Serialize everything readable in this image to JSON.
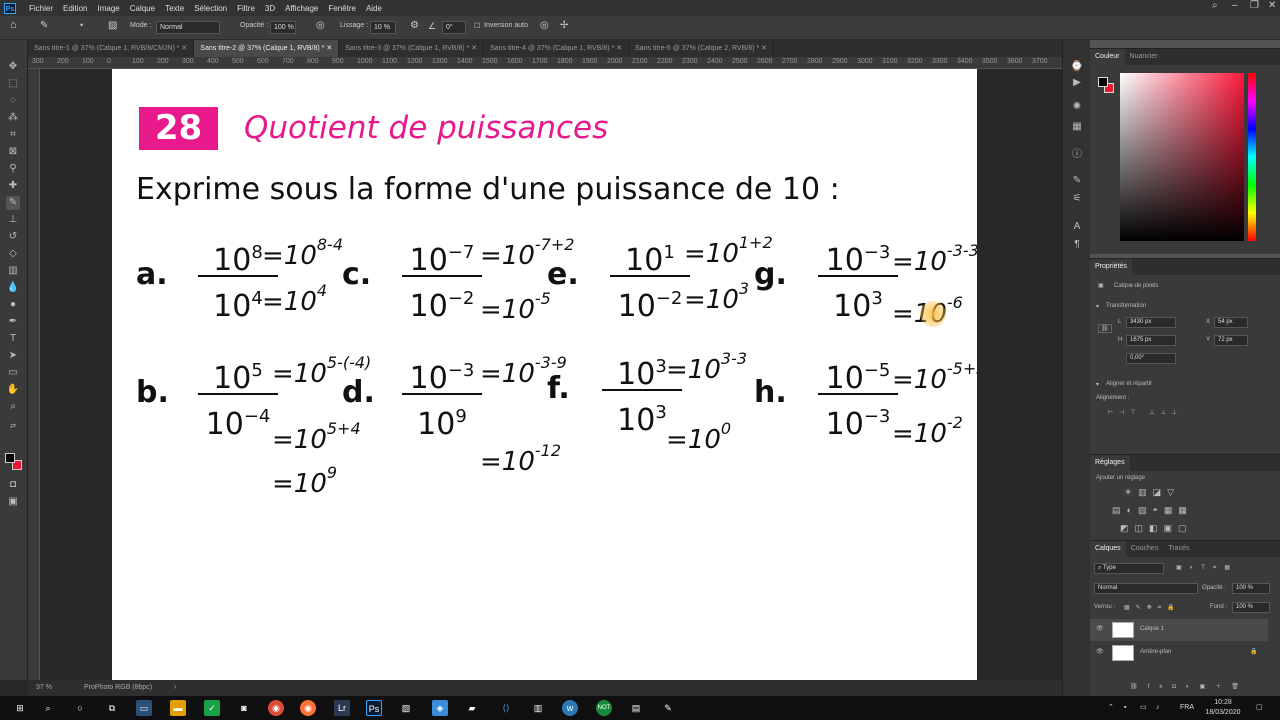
{
  "menubar": {
    "items": [
      "Fichier",
      "Edition",
      "Image",
      "Calque",
      "Texte",
      "Sélection",
      "Filtre",
      "3D",
      "Affichage",
      "Fenêtre",
      "Aide"
    ]
  },
  "options": {
    "mode_label": "Mode :",
    "mode_value": "Normal",
    "opacity_label": "Opacité :",
    "opacity_value": "100 %",
    "smoothing_label": "Lissage :",
    "smoothing_value": "10 %",
    "angle_value": "0°",
    "auto_invert_label": "Inversion auto"
  },
  "tabs": [
    "Sans titre-1 @ 37% (Calque 1, RVB/8/CMJN) *",
    "Sans titre-2 @ 37% (Calque 1, RVB/8) *",
    "Sans titre-3 @ 37% (Calque 1, RVB/8) *",
    "Sans titre-4 @ 37% (Calque 1, RVB/8) *",
    "Sans titre-5 @ 37% (Calque 2, RVB/8) *"
  ],
  "ruler_ticks": [
    "300",
    "200",
    "100",
    "0",
    "100",
    "200",
    "300",
    "400",
    "500",
    "600",
    "700",
    "800",
    "900",
    "1000",
    "1100",
    "1200",
    "1300",
    "1400",
    "1500",
    "1600",
    "1700",
    "1800",
    "1900",
    "2000",
    "2100",
    "2200",
    "2300",
    "2400",
    "2500",
    "2600",
    "2700",
    "2800",
    "2900",
    "3000",
    "3100",
    "3200",
    "3300",
    "3400",
    "3500",
    "3600",
    "3700"
  ],
  "document": {
    "badge": "28",
    "title": "Quotient de puissances",
    "instruction": "Exprime sous la forme d'une puissance de 10 :",
    "exercises": [
      {
        "label": "a.",
        "num_base": "10",
        "num_exp": "8",
        "den_base": "10",
        "den_exp": "4",
        "work": [
          {
            "base": "=10",
            "exp": "8-4"
          },
          {
            "base": "=10",
            "exp": "4"
          }
        ]
      },
      {
        "label": "c.",
        "num_base": "10",
        "num_exp": "−7",
        "den_base": "10",
        "den_exp": "−2",
        "work": [
          {
            "base": "=10",
            "exp": "-7+2"
          },
          {
            "base": "=10",
            "exp": "-5"
          }
        ]
      },
      {
        "label": "e.",
        "num_base": "10",
        "num_exp": "1",
        "den_base": "10",
        "den_exp": "−2",
        "work": [
          {
            "base": "=10",
            "exp": "1+2"
          },
          {
            "base": "=10",
            "exp": "3"
          }
        ]
      },
      {
        "label": "g.",
        "num_base": "10",
        "num_exp": "−3",
        "den_base": "10",
        "den_exp": "3",
        "work": [
          {
            "base": "=10",
            "exp": "-3-3"
          },
          {
            "base": "=10",
            "exp": "-6"
          }
        ]
      },
      {
        "label": "b.",
        "num_base": "10",
        "num_exp": "5",
        "den_base": "10",
        "den_exp": "−4",
        "work": [
          {
            "base": "=10",
            "exp": "5-(-4)"
          },
          {
            "base": "=10",
            "exp": "5+4"
          },
          {
            "base": "=10",
            "exp": "9"
          }
        ]
      },
      {
        "label": "d.",
        "num_base": "10",
        "num_exp": "−3",
        "den_base": "10",
        "den_exp": "9",
        "work": [
          {
            "base": "=10",
            "exp": "-3-9"
          },
          {
            "base": "=10",
            "exp": "-12"
          }
        ]
      },
      {
        "label": "f.",
        "num_base": "10",
        "num_exp": "3",
        "den_base": "10",
        "den_exp": "3",
        "work": [
          {
            "base": "=10",
            "exp": "3-3"
          },
          {
            "base": "=10",
            "exp": "0"
          }
        ]
      },
      {
        "label": "h.",
        "num_base": "10",
        "num_exp": "−5",
        "den_base": "10",
        "den_exp": "−3",
        "work": [
          {
            "base": "=10",
            "exp": "-5+3"
          },
          {
            "base": "=10",
            "exp": "-2"
          }
        ]
      }
    ]
  },
  "status": {
    "zoom": "37 %",
    "profile": "ProPhoto RGB (8bpc)"
  },
  "color_panel": {
    "tabs": [
      "Couleur",
      "Nuancier"
    ],
    "fg": "#000000",
    "bg": "#e8192c"
  },
  "properties": {
    "tab": "Propriétés",
    "layer_type": "Calque de pixels",
    "section": "Transformation",
    "L_label": "L",
    "L_value": "3430 px",
    "X_label": "X",
    "X_value": "54 px",
    "H_label": "H",
    "H_value": "1675 px",
    "Y_label": "Y",
    "Y_value": "72 px",
    "angle_value": "0,00°",
    "align_section": "Aligner et répartir",
    "align_label": "Alignement :"
  },
  "adjustments": {
    "tab": "Réglages",
    "hint": "Ajouter un réglage"
  },
  "layers": {
    "tabs": [
      "Calques",
      "Couches",
      "Tracés"
    ],
    "filter": "Type",
    "blend_mode": "Normal",
    "opacity_label": "Opacité :",
    "opacity_value": "100 %",
    "lock_label": "Verrou :",
    "fill_label": "Fond :",
    "fill_value": "100 %",
    "items": [
      {
        "name": "Calque 1"
      },
      {
        "name": "Arrière-plan"
      }
    ]
  },
  "taskbar": {
    "lang": "FRA",
    "time": "10:28",
    "date": "18/03/2020"
  }
}
